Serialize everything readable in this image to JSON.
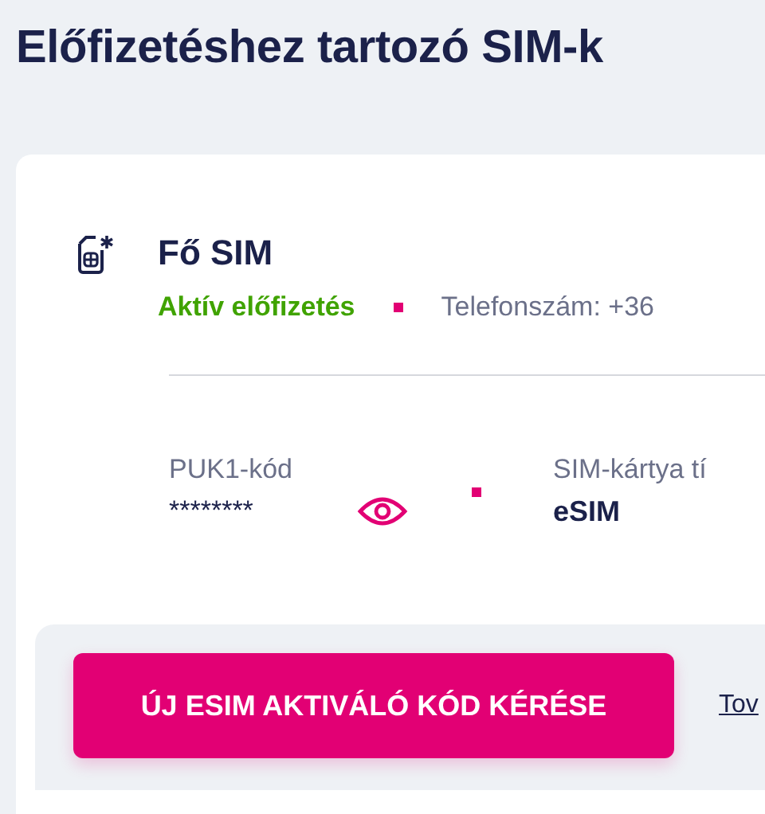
{
  "title": "Előfizetéshez tartozó SIM-k",
  "sim": {
    "name": "Fő SIM",
    "status": "Aktív előfizetés",
    "phone": "Telefonszám: +36"
  },
  "details": [
    {
      "kind": "secret",
      "label": "PUK1-kód",
      "value": "********"
    },
    {
      "kind": "plain",
      "label": "SIM-kártya tí",
      "value": "eSIM"
    }
  ],
  "action_button": "ÚJ ESIM AKTIVÁLÓ KÓD KÉRÉSE",
  "link": "Tov"
}
